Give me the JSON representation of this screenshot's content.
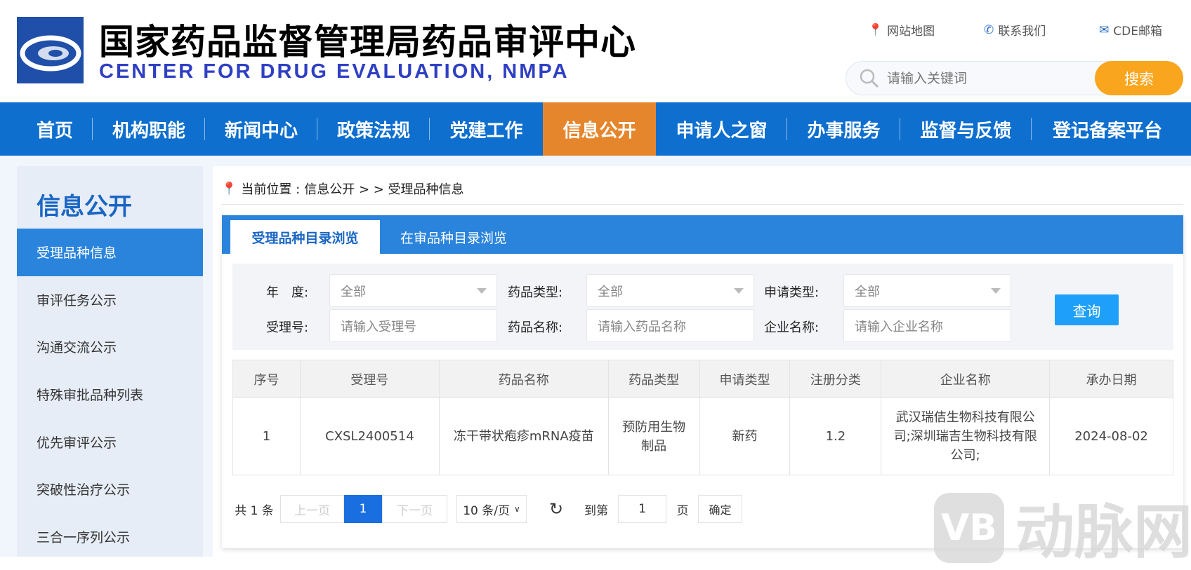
{
  "header": {
    "title": "国家药品监督管理局药品审评中心",
    "subtitle": "CENTER FOR DRUG EVALUATION, NMPA",
    "links": [
      {
        "icon": "map-pin-icon",
        "label": "网站地图"
      },
      {
        "icon": "phone-icon",
        "label": "联系我们"
      },
      {
        "icon": "mail-icon",
        "label": "CDE邮箱"
      }
    ],
    "search": {
      "placeholder": "请输入关键词",
      "button": "搜索"
    }
  },
  "nav": [
    "首页",
    "机构职能",
    "新闻中心",
    "政策法规",
    "党建工作",
    "信息公开",
    "申请人之窗",
    "办事服务",
    "监督与反馈",
    "登记备案平台"
  ],
  "nav_active": "信息公开",
  "sidebar": {
    "title": "信息公开",
    "items": [
      "受理品种信息",
      "审评任务公示",
      "沟通交流公示",
      "特殊审批品种列表",
      "优先审评公示",
      "突破性治疗公示",
      "三合一序列公示"
    ]
  },
  "breadcrumb": {
    "prefix": "当前位置 : ",
    "path": "信息公开 > > 受理品种信息"
  },
  "tabs": [
    "受理品种目录浏览",
    "在审品种目录浏览"
  ],
  "filters": {
    "year_label": "年　度:",
    "year_value": "全部",
    "drug_type_label": "药品类型:",
    "drug_type_value": "全部",
    "apply_type_label": "申请类型:",
    "apply_type_value": "全部",
    "accept_no_label": "受理号:",
    "accept_no_placeholder": "请输入受理号",
    "drug_name_label": "药品名称:",
    "drug_name_placeholder": "请输入药品名称",
    "company_label": "企业名称:",
    "company_placeholder": "请输入企业名称",
    "query_button": "查询"
  },
  "table": {
    "headers": [
      "序号",
      "受理号",
      "药品名称",
      "药品类型",
      "申请类型",
      "注册分类",
      "企业名称",
      "承办日期"
    ],
    "rows": [
      [
        "1",
        "CXSL2400514",
        "冻干带状疱疹mRNA疫苗",
        "预防用生物制品",
        "新药",
        "1.2",
        "武汉瑞佶生物科技有限公司;深圳瑞吉生物科技有限公司;",
        "2024-08-02"
      ]
    ]
  },
  "pagination": {
    "total": "共 1 条",
    "prev": "上一页",
    "current": "1",
    "next": "下一页",
    "page_size": "10 条/页",
    "goto_label": "到第",
    "goto_value": "1",
    "page_unit": "页",
    "confirm": "确定"
  },
  "watermark": "动脉网",
  "colors": {
    "nav": "#0e6fce",
    "active_nav": "#e5862c",
    "search_button": "#f9a61e",
    "query_button": "#1ea0fa"
  }
}
